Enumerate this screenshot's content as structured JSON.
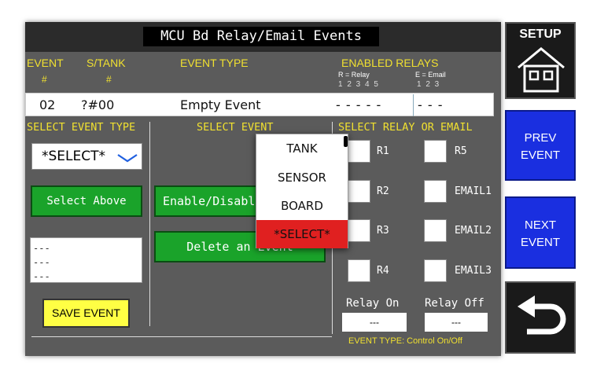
{
  "title": "MCU Bd Relay/Email Events",
  "headers": {
    "event": "EVENT",
    "event_sub": "#",
    "stank": "S/TANK",
    "stank_sub": "#",
    "event_type": "EVENT TYPE",
    "enabled_relays": "ENABLED RELAYS",
    "relay_legend": "R = Relay",
    "email_legend": "E = Email",
    "relay_nums": "1 2 3 4 5",
    "email_nums": "1 2 3"
  },
  "event_row": {
    "number": "02",
    "tank": "?#00",
    "type": "Empty Event",
    "relays": "- - - - -",
    "emails": "- - -"
  },
  "sections": {
    "select_event_type": "SELECT EVENT TYPE",
    "select_event": "SELECT EVENT",
    "select_relay_or_email": "SELECT RELAY OR EMAIL"
  },
  "select_value": "*SELECT*",
  "buttons": {
    "select_above": "Select Above",
    "enable_disable": "Enable/Disable",
    "delete": "Delete an Event",
    "save": "SAVE EVENT"
  },
  "textbox_lines": [
    "---",
    "---",
    "---"
  ],
  "dropdown": [
    "TANK",
    "SENSOR",
    "BOARD",
    "*SELECT*"
  ],
  "checkboxes": {
    "r1": "R1",
    "r2": "R2",
    "r3": "R3",
    "r4": "R4",
    "r5": "R5",
    "email1": "EMAIL1",
    "email2": "EMAIL2",
    "email3": "EMAIL3"
  },
  "relay_on": "Relay On",
  "relay_off": "Relay Off",
  "relay_on_value": "---",
  "relay_off_value": "---",
  "event_type_footer": "EVENT TYPE: Control On/Off",
  "sidebar": {
    "setup": "SETUP",
    "prev_1": "PREV",
    "prev_2": "EVENT",
    "next_1": "NEXT",
    "next_2": "EVENT"
  },
  "colors": {
    "header_yellow": "#f0e030",
    "button_green": "#1aa32a",
    "sidebar_blue": "#1a2fe0",
    "dropdown_selected": "#e02020"
  }
}
